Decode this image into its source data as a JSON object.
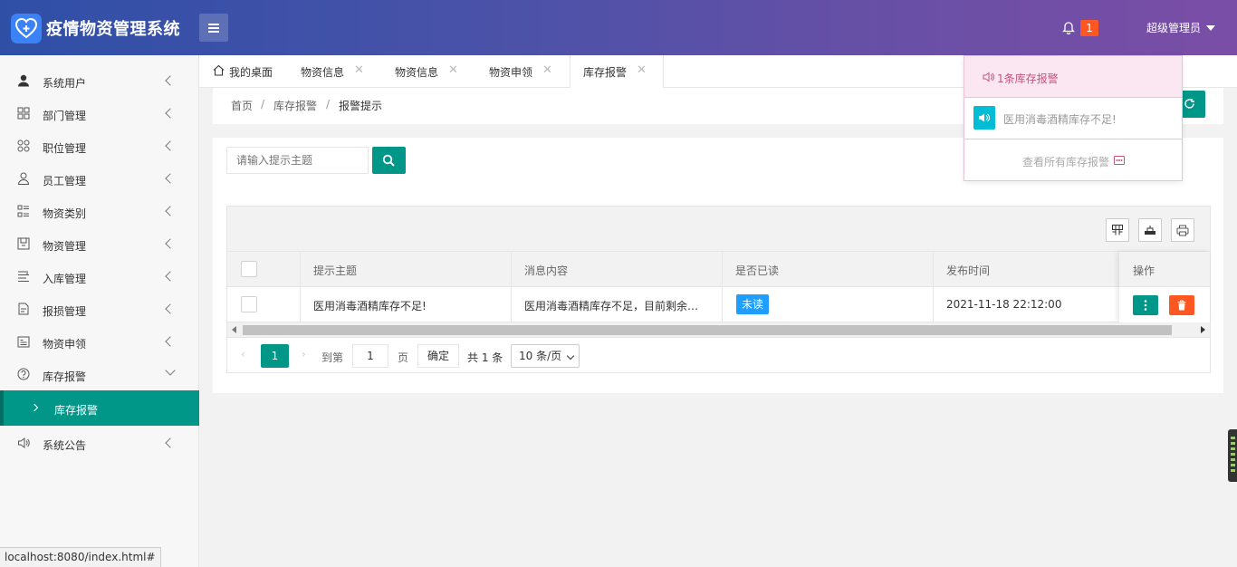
{
  "header": {
    "app_title": "疫情物资管理系统",
    "notification_count": "1",
    "user_name": "超级管理员"
  },
  "sidebar": {
    "items": [
      {
        "label": "系统用户",
        "icon": "user-icon"
      },
      {
        "label": "部门管理",
        "icon": "grid-icon"
      },
      {
        "label": "职位管理",
        "icon": "apps-icon"
      },
      {
        "label": "员工管理",
        "icon": "person-icon"
      },
      {
        "label": "物资类别",
        "icon": "list-icon"
      },
      {
        "label": "物资管理",
        "icon": "box-icon"
      },
      {
        "label": "入库管理",
        "icon": "lines-icon"
      },
      {
        "label": "报损管理",
        "icon": "doc-icon"
      },
      {
        "label": "物资申领",
        "icon": "calendar-icon"
      },
      {
        "label": "库存报警",
        "icon": "question-icon"
      },
      {
        "label": "系统公告",
        "icon": "speaker-icon"
      }
    ],
    "sub_item": "库存报警"
  },
  "tabs": [
    {
      "label": "我的桌面"
    },
    {
      "label": "物资信息"
    },
    {
      "label": "物资信息"
    },
    {
      "label": "物资申领"
    },
    {
      "label": "库存报警"
    }
  ],
  "breadcrumb": {
    "home": "首页",
    "sep": "/",
    "level1": "库存报警",
    "level2": "报警提示"
  },
  "search": {
    "placeholder": "请输入提示主题",
    "value": ""
  },
  "table": {
    "columns": [
      "提示主题",
      "消息内容",
      "是否已读",
      "发布时间",
      "操作"
    ],
    "rows": [
      {
        "subject": "医用消毒酒精库存不足!",
        "content": "医用消毒酒精库存不足，目前剩余…",
        "read_status": "未读",
        "published": "2021-11-18 22:12:00"
      }
    ]
  },
  "pager": {
    "current_page": "1",
    "goto_label": "到第",
    "goto_value": "1",
    "page_unit": "页",
    "confirm_label": "确定",
    "total_label": "共 1 条",
    "page_size": "10 条/页"
  },
  "notifications": {
    "header": "1条库存报警",
    "items": [
      {
        "text": "医用消毒酒精库存不足!"
      }
    ],
    "footer": "查看所有库存报警"
  },
  "status_bar": {
    "url": "localhost:8080/index.html#"
  },
  "colors": {
    "primary": "#009688",
    "danger": "#ff5722",
    "info": "#1e9fff",
    "accent": "#00bcd4"
  }
}
